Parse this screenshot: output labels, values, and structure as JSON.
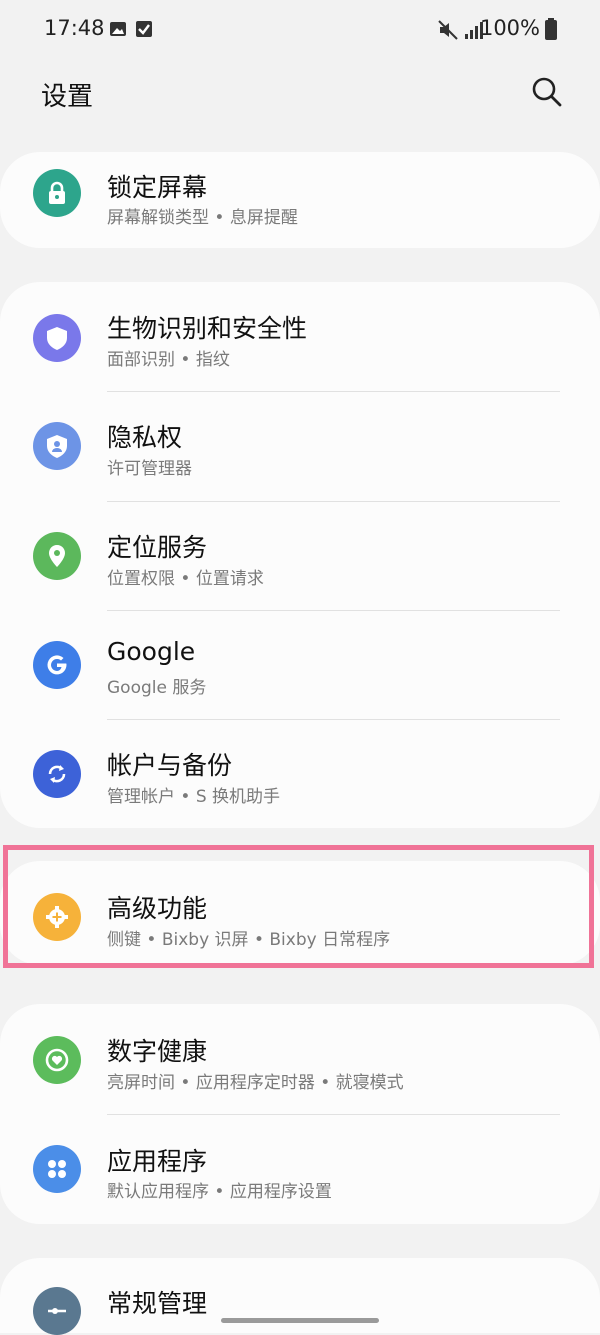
{
  "status": {
    "time": "17:48",
    "battery": "100%"
  },
  "header": {
    "title": "设置"
  },
  "items": [
    {
      "title": "锁定屏幕",
      "subtitle": "屏幕解锁类型 • 息屏提醒",
      "icon": "lock-icon",
      "color": "#2da58c"
    },
    {
      "title": "生物识别和安全性",
      "subtitle": "面部识别 • 指纹",
      "icon": "shield-icon",
      "color": "#7a78ea"
    },
    {
      "title": "隐私权",
      "subtitle": "许可管理器",
      "icon": "privacy-shield-icon",
      "color": "#6d94e6"
    },
    {
      "title": "定位服务",
      "subtitle": "位置权限 • 位置请求",
      "icon": "location-pin-icon",
      "color": "#5cb85c"
    },
    {
      "title": "Google",
      "subtitle": "Google 服务",
      "icon": "google-icon",
      "color": "#3e7ee8"
    },
    {
      "title": "帐户与备份",
      "subtitle": "管理帐户 • S 换机助手",
      "icon": "sync-icon",
      "color": "#3d62d8"
    },
    {
      "title": "高级功能",
      "subtitle": "侧键 • Bixby 识屏 • Bixby 日常程序",
      "icon": "gear-plus-icon",
      "color": "#f6b23a"
    },
    {
      "title": "数字健康",
      "subtitle": "亮屏时间 • 应用程序定时器 • 就寝模式",
      "icon": "heart-circle-icon",
      "color": "#5cbc5c"
    },
    {
      "title": "应用程序",
      "subtitle": "默认应用程序 • 应用程序设置",
      "icon": "apps-grid-icon",
      "color": "#4b8ee8"
    },
    {
      "title": "常规管理",
      "subtitle": "",
      "icon": "sliders-icon",
      "color": "#5a7890"
    }
  ]
}
